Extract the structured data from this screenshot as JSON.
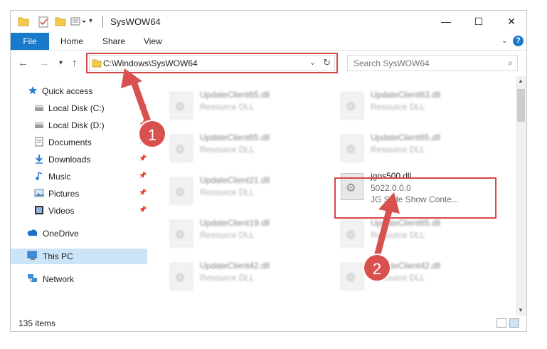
{
  "window": {
    "title": "SysWOW64",
    "minimize_glyph": "—",
    "maximize_glyph": "☐",
    "close_glyph": "✕"
  },
  "ribbon": {
    "tabs": [
      "File",
      "Home",
      "Share",
      "View"
    ],
    "help_glyph": "?"
  },
  "navbar": {
    "address": "C:\\Windows\\SysWOW64",
    "search_placeholder": "Search SysWOW64"
  },
  "sidebar": {
    "items": [
      {
        "label": "Quick access",
        "icon": "star-icon"
      },
      {
        "label": "Local Disk (C:)",
        "icon": "drive-icon"
      },
      {
        "label": "Local Disk (D:)",
        "icon": "drive-icon"
      },
      {
        "label": "Documents",
        "icon": "documents-icon"
      },
      {
        "label": "Downloads",
        "icon": "download-icon"
      },
      {
        "label": "Music",
        "icon": "music-icon"
      },
      {
        "label": "Pictures",
        "icon": "pictures-icon"
      },
      {
        "label": "Videos",
        "icon": "videos-icon"
      },
      {
        "label": "OneDrive",
        "icon": "cloud-icon"
      },
      {
        "label": "This PC",
        "icon": "computer-icon"
      },
      {
        "label": "Network",
        "icon": "network-icon"
      }
    ]
  },
  "files": [
    {
      "name": "UpdateClient65.dll",
      "type": "Resource DLL"
    },
    {
      "name": "UpdateClient63.dll",
      "type": "Resource DLL"
    },
    {
      "name": "UpdateClient65.dll",
      "type": "Resource DLL"
    },
    {
      "name": "UpdateClient65.dll",
      "type": "Resource DLL"
    },
    {
      "name": "UpdateClient21.dll",
      "type": "Resource DLL"
    },
    {
      "name": "jgos500.dll",
      "version": "5022.0.0.0",
      "description": "JG Slide Show Conte..."
    },
    {
      "name": "UpdateClient19.dll",
      "type": "Resource DLL"
    },
    {
      "name": "UpdateClient65.dll",
      "type": "Resource DLL"
    },
    {
      "name": "UpdateClient42.dll",
      "type": "Resource DLL"
    },
    {
      "name": "UpdateClient42.dll",
      "type": "Resource DLL"
    }
  ],
  "status": {
    "item_count": "135 items"
  },
  "callouts": [
    "1",
    "2"
  ],
  "colors": {
    "accent": "#1979ca",
    "highlight": "#d94646",
    "selected": "#cce4f7",
    "callout": "#d9514f"
  }
}
